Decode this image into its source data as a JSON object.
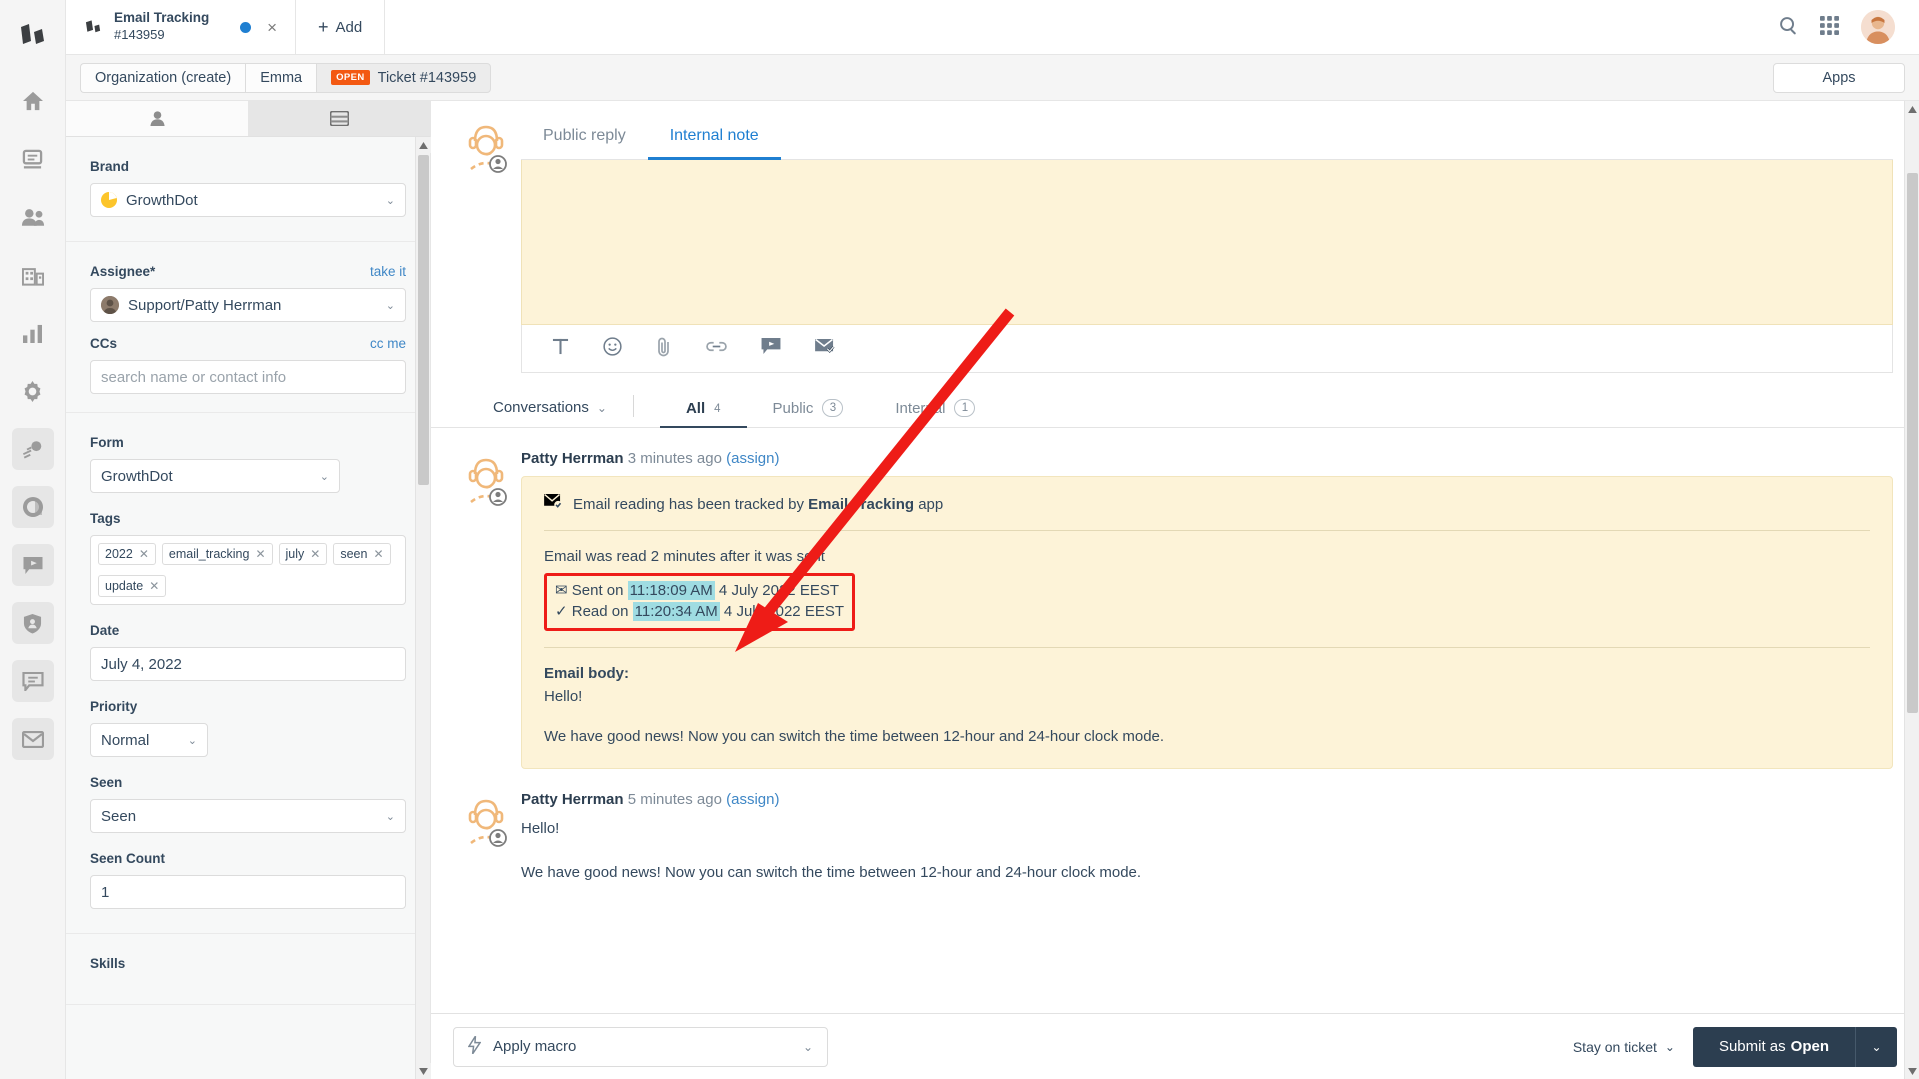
{
  "window": {
    "tab": {
      "title": "Email Tracking",
      "subtitle": "#143959",
      "close": "×"
    },
    "add_label": "Add",
    "add_plus": "+"
  },
  "breadcrumb": {
    "items": [
      "Organization (create)",
      "Emma"
    ],
    "state_badge": "OPEN",
    "ticket": "Ticket #143959",
    "apps_label": "Apps"
  },
  "rail": {
    "items": [
      {
        "name": "home-icon",
        "label": "Home"
      },
      {
        "name": "overviews-icon",
        "label": "Overviews"
      },
      {
        "name": "customers-icon",
        "label": "Customers"
      },
      {
        "name": "organizations-icon",
        "label": "Organizations"
      },
      {
        "name": "reporting-icon",
        "label": "Reporting"
      },
      {
        "name": "settings-icon",
        "label": "Settings"
      },
      {
        "name": "highlight-icon",
        "label": "Highlight"
      },
      {
        "name": "dashboard-icon",
        "label": "Dashboard"
      },
      {
        "name": "chat-icon",
        "label": "Chat"
      },
      {
        "name": "shield-icon",
        "label": "Security"
      },
      {
        "name": "note-icon",
        "label": "Notes"
      },
      {
        "name": "mail-icon",
        "label": "Mail"
      }
    ]
  },
  "sidebar": {
    "tabs": [
      {
        "name": "customer-tab",
        "icon": "person-icon",
        "active": false
      },
      {
        "name": "ticket-tab",
        "icon": "ticket-icon",
        "active": true
      }
    ],
    "brand": {
      "label": "Brand",
      "value": "GrowthDot"
    },
    "assignee": {
      "label": "Assignee*",
      "action": "take it",
      "value": "Support/Patty Herrman"
    },
    "ccs": {
      "label": "CCs",
      "action": "cc me",
      "placeholder": "search name or contact info",
      "value": ""
    },
    "form": {
      "label": "Form",
      "value": "GrowthDot"
    },
    "tags": {
      "label": "Tags",
      "items": [
        "2022",
        "email_tracking",
        "july",
        "seen",
        "update"
      ],
      "remove_glyph": "✕"
    },
    "date": {
      "label": "Date",
      "value": "July 4, 2022"
    },
    "priority": {
      "label": "Priority",
      "value": "Normal"
    },
    "seen": {
      "label": "Seen",
      "value": "Seen"
    },
    "seen_count": {
      "label": "Seen Count",
      "value": "1"
    },
    "skills": {
      "label": "Skills"
    }
  },
  "compose": {
    "tabs": [
      {
        "label": "Public reply",
        "active": false
      },
      {
        "label": "Internal note",
        "active": true
      }
    ],
    "body": "",
    "toolbar": [
      {
        "name": "text-format-icon",
        "glyph": "T"
      },
      {
        "name": "emoji-icon",
        "glyph": "☺"
      },
      {
        "name": "attachment-icon",
        "glyph": "📎"
      },
      {
        "name": "link-icon",
        "glyph": "🔗"
      },
      {
        "name": "knowledge-base-icon",
        "glyph": "▶"
      },
      {
        "name": "email-tracking-icon",
        "glyph": "✉"
      }
    ]
  },
  "conversation_bar": {
    "label": "Conversations",
    "filters": [
      {
        "label": "All",
        "count": "4",
        "style": "plain",
        "active": true
      },
      {
        "label": "Public",
        "count": "3",
        "style": "pill",
        "active": false
      },
      {
        "label": "Internal",
        "count": "1",
        "style": "pill",
        "active": false
      }
    ]
  },
  "articles": [
    {
      "author": "Patty Herrman",
      "time": "3 minutes ago",
      "assign": "(assign)",
      "type": "bubble",
      "tracking_headline_pre": "Email reading has been tracked by ",
      "tracking_headline_app": "Email Tracking",
      "tracking_headline_post": " app",
      "read_summary": "Email was read 2 minutes after it was sent",
      "sent_label": "Sent on ",
      "sent_time": "11:18:09 AM",
      "sent_date": " 4 July 2022 EEST",
      "read_label": "Read on ",
      "read_time": "11:20:34 AM",
      "read_date": " 4 July 2022 EEST",
      "sent_glyph": "✉",
      "read_glyph": "✓",
      "body_label": "Email body:",
      "body_line1": "Hello!",
      "body_line2": "We have good news! Now you can switch the time between 12-hour and 24-hour clock mode."
    },
    {
      "author": "Patty Herrman",
      "time": "5 minutes ago",
      "assign": "(assign)",
      "type": "plain",
      "body_line1": "Hello!",
      "body_line2": "We have good news! Now you can switch the time between 12-hour and 24-hour clock mode."
    }
  ],
  "footer": {
    "macro_label": "Apply macro",
    "stay_label": "Stay on ticket",
    "submit_prefix": "Submit as ",
    "submit_state": "Open",
    "caret": "⌄"
  },
  "colors": {
    "accent_blue": "#1f7fd1",
    "state_orange": "#f35912",
    "note_yellow": "#fdf3d8",
    "highlight_cyan": "#9fdce2",
    "annotation_red": "#ee1c17",
    "submit_dark": "#2c3e50"
  }
}
